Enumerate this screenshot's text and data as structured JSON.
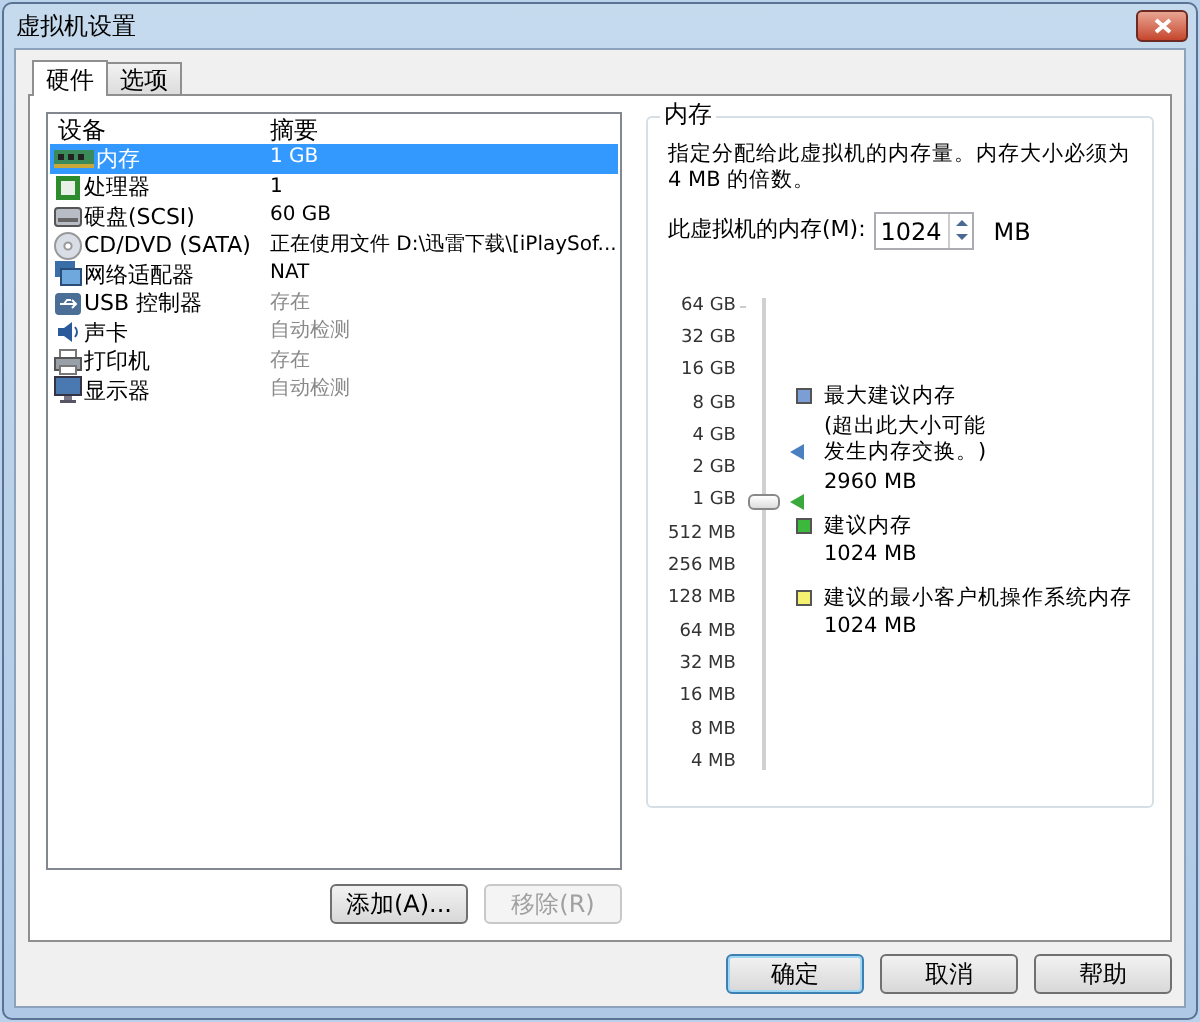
{
  "window": {
    "title": "虚拟机设置"
  },
  "tabs": [
    {
      "label": "硬件",
      "selected": true
    },
    {
      "label": "选项",
      "selected": false
    }
  ],
  "device_table": {
    "columns": [
      "设备",
      "摘要"
    ],
    "rows": [
      {
        "kind": "memory",
        "device": "内存",
        "summary": "1 GB",
        "selected": true,
        "disabled": false
      },
      {
        "kind": "cpu",
        "device": "处理器",
        "summary": "1",
        "selected": false,
        "disabled": false
      },
      {
        "kind": "disk",
        "device": "硬盘(SCSI)",
        "summary": "60 GB",
        "selected": false,
        "disabled": false
      },
      {
        "kind": "cd",
        "device": "CD/DVD (SATA)",
        "summary": "正在使用文件 D:\\迅雷下载\\[iPlaySof...",
        "selected": false,
        "disabled": false
      },
      {
        "kind": "network",
        "device": "网络适配器",
        "summary": "NAT",
        "selected": false,
        "disabled": false
      },
      {
        "kind": "usb",
        "device": "USB 控制器",
        "summary": "存在",
        "selected": false,
        "disabled": true
      },
      {
        "kind": "sound",
        "device": "声卡",
        "summary": "自动检测",
        "selected": false,
        "disabled": true
      },
      {
        "kind": "printer",
        "device": "打印机",
        "summary": "存在",
        "selected": false,
        "disabled": true
      },
      {
        "kind": "display",
        "device": "显示器",
        "summary": "自动检测",
        "selected": false,
        "disabled": true
      }
    ]
  },
  "list_buttons": [
    {
      "label": "添加(A)...",
      "disabled": false
    },
    {
      "label": "移除(R)",
      "disabled": true
    }
  ],
  "memory_group": {
    "title": "内存",
    "description": "指定分配给此虚拟机的内存量。内存大小必须为 4 MB 的倍数。",
    "field_label": "此虚拟机的内存(M):",
    "value": "1024",
    "unit": "MB",
    "scale": [
      "64 GB",
      "32 GB",
      "16 GB",
      "8 GB",
      "4 GB",
      "2 GB",
      "1 GB",
      "512 MB",
      "256 MB",
      "128 MB",
      "64 MB",
      "32 MB",
      "16 MB",
      "8 MB",
      "4 MB"
    ],
    "slider": {
      "level": 0.571
    },
    "markers": [
      {
        "color": "#4a7fc0",
        "level": 0.681
      },
      {
        "color": "#3aa83a",
        "level": 0.571
      }
    ],
    "legend": [
      {
        "color": "#7b9fd4",
        "title": "最大建议内存",
        "note": "(超出此大小可能发生内存交换。)",
        "value": "2960 MB"
      },
      {
        "color": "#3cb83c",
        "title": "建议内存",
        "value": "1024 MB"
      },
      {
        "color": "#f4f070",
        "title": "建议的最小客户机操作系统内存",
        "value": "1024 MB"
      }
    ]
  },
  "dialog_buttons": [
    {
      "label": "确定",
      "default": true
    },
    {
      "label": "取消",
      "default": false
    },
    {
      "label": "帮助",
      "default": false
    }
  ]
}
